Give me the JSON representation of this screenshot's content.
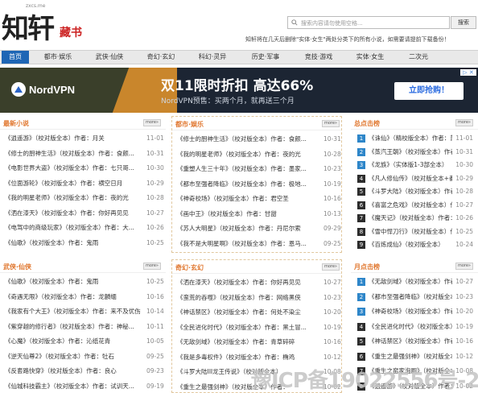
{
  "header": {
    "logo_text": "知轩",
    "logo_seal": "藏书",
    "logo_url": "zxcs.me",
    "search_placeholder": "搜索内容请勿使用空格...",
    "search_button": "搜索",
    "notice": "知轩将在几天后删除\"实体·女生\"两处分类下的所有小说，如需要请提前下载备份！"
  },
  "nav": {
    "items": [
      "首页",
      "都市·娱乐",
      "武侠·仙侠",
      "奇幻·玄幻",
      "科幻·灵异",
      "历史·军事",
      "竞技·游戏",
      "实体·女生",
      "二次元"
    ],
    "active_index": 0
  },
  "ad": {
    "brand": "NordVPN",
    "headline": "双11限时折扣 高达66%",
    "sub": "NordVPN预售：买两个月，就再送三个月",
    "button": "立即抢购！",
    "close": "▷ ✕"
  },
  "panels": {
    "latest": {
      "title": "最新小说",
      "more": "more»",
      "rows": [
        {
          "book": "《逍遥游》",
          "tail": "（校对版全本）作者：月关",
          "date": "11-01"
        },
        {
          "book": "《修士的厨神生活》",
          "tail": "（校对版全本）作者：食颜...",
          "date": "10-31"
        },
        {
          "book": "《电影世界大盗》",
          "tail": "（校对版全本）作者：七只哥...",
          "date": "10-30"
        },
        {
          "book": "《位面游轮》",
          "tail": "（校对版全本）作者：横空日月",
          "date": "10-29"
        },
        {
          "book": "《我的明星老师》",
          "tail": "（校对版全本）作者：夜的光",
          "date": "10-28"
        },
        {
          "book": "《洒在漆天》",
          "tail": "（校对版全本）作者：你好再见见",
          "date": "10-27"
        },
        {
          "book": "《电驾中的商级玩家》",
          "tail": "（校对版全本）作者：大...",
          "date": "10-26"
        },
        {
          "book": "《仙歌》",
          "tail": "（校对版全本）作者：鬼雨",
          "date": "10-25"
        }
      ]
    },
    "dushi": {
      "title": "都市·娱乐",
      "more": "more»",
      "rows": [
        {
          "book": "《修士的厨神生活》",
          "tail": "（校对版全本）作者：食颜...",
          "date": "10-31"
        },
        {
          "book": "《我的明星老师》",
          "tail": "（校对版全本）作者：夜的光",
          "date": "10-28"
        },
        {
          "book": "《重塑人生三十年》",
          "tail": "（校对版全本）作者：墨家...",
          "date": "10-23"
        },
        {
          "book": "《都市至强者降临》",
          "tail": "（校对版全本）作者：极地...",
          "date": "10-19"
        },
        {
          "book": "《神奇校场》",
          "tail": "（校对版全本）作者：君空圣",
          "date": "10-16"
        },
        {
          "book": "《画中王》",
          "tail": "（校对版全本）作者：甘甜",
          "date": "10-13"
        },
        {
          "book": "《苏人大明星》",
          "tail": "（校对版全本）作者：丹尼尔索",
          "date": "09-29"
        },
        {
          "book": "《我不是大明星啊》",
          "tail": "（校对版全本）作者：恩马...",
          "date": "09-25"
        }
      ]
    },
    "wuxia": {
      "title": "武侠·仙侠",
      "more": "more»",
      "rows": [
        {
          "book": "《仙歌》",
          "tail": "（校对版全本）作者：鬼雨",
          "date": "10-25"
        },
        {
          "book": "《奇遇无限》",
          "tail": "（校对版全本）作者：龙麟缅",
          "date": "10-16"
        },
        {
          "book": "《我家有个大王》",
          "tail": "（校对版全本）作者：来不及优伤",
          "date": "10-14"
        },
        {
          "book": "《紫穿越的修行者》",
          "tail": "（校对版全本）作者：神秘...",
          "date": "10-11"
        },
        {
          "book": "《心魔》",
          "tail": "（校对版全本）作者：沁纸花青",
          "date": "10-05"
        },
        {
          "book": "《逆天仙尊2》",
          "tail": "（校对版全本）作者：牡石",
          "date": "09-25"
        },
        {
          "book": "《反套路快穿》",
          "tail": "（校对版全本）作者：良心",
          "date": "09-23"
        },
        {
          "book": "《仙城科技霸主》",
          "tail": "（校对版全本）作者：试训天...",
          "date": "09-19"
        }
      ]
    },
    "qihuan": {
      "title": "奇幻·玄幻",
      "more": "more»",
      "rows": [
        {
          "book": "《洒在漆天》",
          "tail": "（校对版全本）作者：你好再见见",
          "date": "10-27"
        },
        {
          "book": "《蛮荒的吞噬》",
          "tail": "（校对版全本）作者：网络黑侠",
          "date": "10-23"
        },
        {
          "book": "《神话禁区》",
          "tail": "（校对版全本）作者：何处不染尘",
          "date": "10-20"
        },
        {
          "book": "《全民进化时代》",
          "tail": "（校对版全本）作者：黑土冒...",
          "date": "10-19"
        },
        {
          "book": "《无敌剑域》",
          "tail": "（校对版全本）作者：青草碎碎",
          "date": "10-16"
        },
        {
          "book": "《我是多毒权件》",
          "tail": "（校对版全本）作者：椭鸡",
          "date": "10-12"
        },
        {
          "book": "《斗罗大陆III龙王传说》",
          "tail": "（校对版全本）",
          "date": "10-08"
        },
        {
          "book": "《重生之最强剑神》",
          "tail": "（校对版全本）作者：",
          "date": "10-02"
        }
      ]
    },
    "rank_total": {
      "title": "总点击榜",
      "more": "more»",
      "rows": [
        {
          "num": "1",
          "text": "《诛仙》（精校版全本）作者：萧鼎",
          "date": "11-01"
        },
        {
          "num": "2",
          "text": "《蒸汽王朝》（校对版全本）作者：",
          "date": "10-31"
        },
        {
          "num": "3",
          "text": "《龙族》（实体版1-3部全本）",
          "date": "10-30"
        },
        {
          "num": "4",
          "text": "《凡人修仙传》（校对版全本+番外）",
          "date": "10-29"
        },
        {
          "num": "5",
          "text": "《斗罗大陆》（校对版全本）作者：",
          "date": "10-28"
        },
        {
          "num": "6",
          "text": "《喜富之危戏》（校对版全本）作者：",
          "date": "10-27"
        },
        {
          "num": "7",
          "text": "《魔天记》（校对版全本）作者：忘",
          "date": "10-26"
        },
        {
          "num": "8",
          "text": "《雪中悍刀行》（校对版全本）作者：",
          "date": "10-25"
        },
        {
          "num": "9",
          "text": "《百炼成仙》（校对版全本）",
          "date": "10-24"
        }
      ]
    },
    "rank_month": {
      "title": "月点击榜",
      "more": "more»",
      "rows": [
        {
          "num": "1",
          "text": "《无敌剑域》（校对版全本）作者：",
          "date": "10-27"
        },
        {
          "num": "2",
          "text": "《都市至强者降临》（校对版全本）",
          "date": "10-23"
        },
        {
          "num": "3",
          "text": "《神奇校场》（校对版全本）作者：",
          "date": "10-20"
        },
        {
          "num": "4",
          "text": "《全民进化时代》（校对版全本）",
          "date": "10-19"
        },
        {
          "num": "5",
          "text": "《神话禁区》（校对版全本）作者：",
          "date": "10-16"
        },
        {
          "num": "6",
          "text": "《重生之最强剑神》（校对版全本）",
          "date": "10-12"
        },
        {
          "num": "7",
          "text": "《重生之窑家泡厕》（校对版全本）",
          "date": "10-08"
        },
        {
          "num": "8",
          "text": "《逍遥游》（校对版全本）作者：月关",
          "date": "10-02"
        }
      ]
    }
  },
  "watermark": "豫ICP备19022556号-2",
  "colors": {
    "nav_active": "#1f66b5",
    "panel_title": "#e0772f",
    "rank_top": "#2e86c9",
    "rank_normal": "#2d2d2d"
  }
}
